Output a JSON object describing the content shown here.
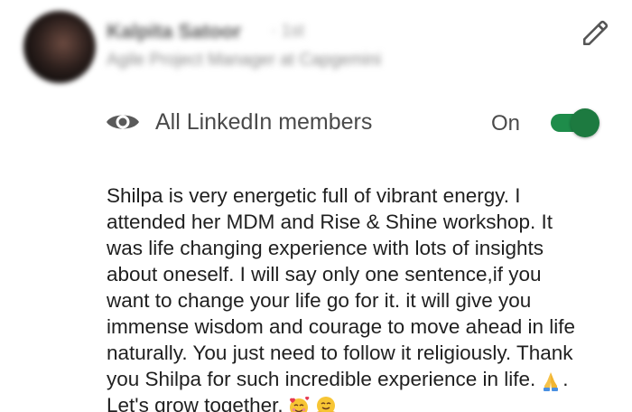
{
  "author": {
    "name": "Kalpita Satoor",
    "degree": "· 1st",
    "headline": "Agile Project Manager at Capgemini"
  },
  "icons": {
    "edit": "pencil-icon",
    "visibility": "eye-icon",
    "emoji_1": "folded-hands-emoji",
    "emoji_2": "smiling-face-with-hearts-emoji",
    "emoji_3": "hugging-face-emoji"
  },
  "visibility": {
    "label": "All LinkedIn members",
    "state_label": "On",
    "enabled": true
  },
  "recommendation": {
    "lines": [
      "Shilpa is very energetic full of vibrant energy. I",
      "attended her MDM and Rise & Shine workshop. It",
      "was life changing experience with lots of insights",
      "about oneself. I will say only one sentence,if you",
      "want to change your life go for it. it will give you",
      "immense wisdom and courage to move ahead in life",
      "naturally. You just need to follow it religiously. Thank",
      "you Shilpa for such incredible experience in life.",
      "Let's grow together."
    ],
    "line8_suffix": "."
  },
  "colors": {
    "toggle_on": "#1e8c4a",
    "text": "#1f1f1f",
    "secondary_text": "#4a4a4a"
  }
}
